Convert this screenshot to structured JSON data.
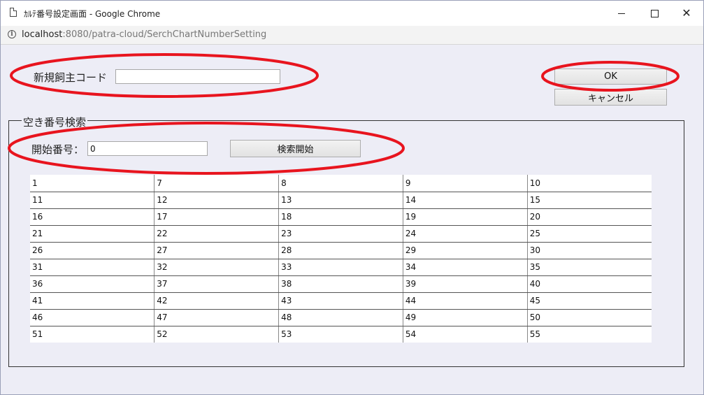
{
  "window": {
    "title": "ｶﾙﾃ番号設定画面 - Google Chrome",
    "url_host": "localhost",
    "url_rest": ":8080/patra-cloud/SerchChartNumberSetting"
  },
  "form": {
    "new_owner_code_label": "新規飼主コード",
    "new_owner_code_value": "",
    "ok_label": "OK",
    "cancel_label": "キャンセル"
  },
  "search": {
    "group_label": "空き番号検索",
    "start_number_label": "開始番号：",
    "start_number_value": "0",
    "search_button_label": "検索開始"
  },
  "results": [
    [
      "1",
      "7",
      "8",
      "9",
      "10"
    ],
    [
      "11",
      "12",
      "13",
      "14",
      "15"
    ],
    [
      "16",
      "17",
      "18",
      "19",
      "20"
    ],
    [
      "21",
      "22",
      "23",
      "24",
      "25"
    ],
    [
      "26",
      "27",
      "28",
      "29",
      "30"
    ],
    [
      "31",
      "32",
      "33",
      "34",
      "35"
    ],
    [
      "36",
      "37",
      "38",
      "39",
      "40"
    ],
    [
      "41",
      "42",
      "43",
      "44",
      "45"
    ],
    [
      "46",
      "47",
      "48",
      "49",
      "50"
    ],
    [
      "51",
      "52",
      "53",
      "54",
      "55"
    ]
  ],
  "annotation_color": "#e8141e"
}
